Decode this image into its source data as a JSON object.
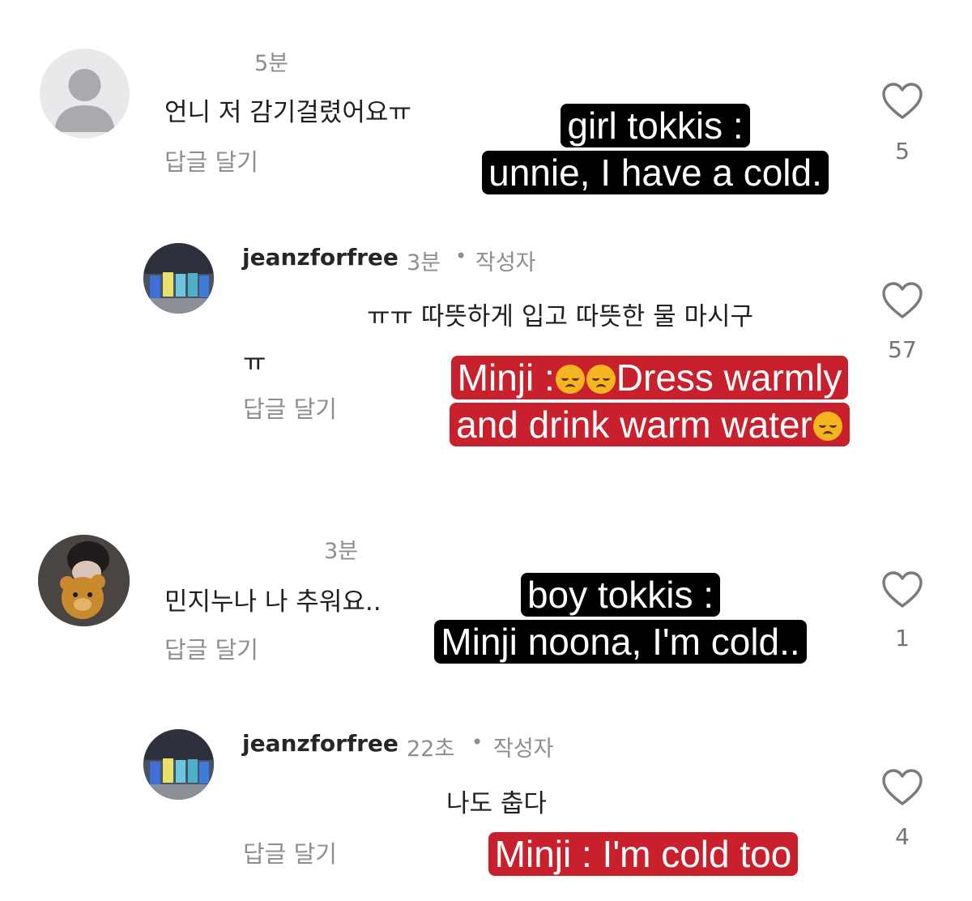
{
  "comments": [
    {
      "time": "5분",
      "text": "언니 저 감기걸렸어요ㅠ",
      "reply_label": "답글 달기",
      "likes": "5",
      "caption_lines": [
        "girl tokkis :",
        "unnie, I have a cold."
      ]
    },
    {
      "username": "jeanzforfree",
      "time": "3분",
      "author_badge": "작성자",
      "text_line1": "ㅠㅠ 따뜻하게 입고 따뜻한 물 마시구",
      "text_line2": "ㅠ",
      "reply_label": "답글 달기",
      "likes": "57",
      "caption_prefix": "Minji : ",
      "caption_rest": "Dress warmly",
      "caption_line2": "and drink warm water"
    },
    {
      "time": "3분",
      "text": "민지누나 나 추워요..",
      "reply_label": "답글 달기",
      "likes": "1",
      "caption_lines": [
        "boy tokkis :",
        "Minji noona, I'm cold.."
      ]
    },
    {
      "username": "jeanzforfree",
      "time": "22초",
      "author_badge": "작성자",
      "text": "나도 춥다",
      "reply_label": "답글 달기",
      "likes": "4",
      "caption_lines": [
        "Minji : I'm cold too"
      ]
    }
  ],
  "separator": "•",
  "icons": {
    "like": "heart-outline-icon",
    "emoji": "disappointed-face-emoji"
  },
  "colors": {
    "caption_black": "#000000",
    "caption_red": "#c8202c",
    "muted": "#8e8e8e"
  }
}
